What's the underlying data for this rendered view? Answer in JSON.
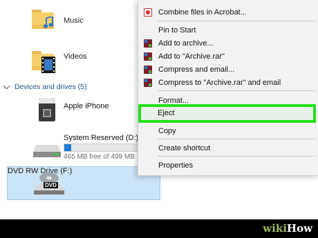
{
  "folders": [
    {
      "label": "Music"
    },
    {
      "label": "Videos"
    }
  ],
  "section": {
    "label": "Devices and drives (5)"
  },
  "devices": {
    "iphone": {
      "label": "Apple iPhone"
    },
    "system_reserved": {
      "label": "System Reserved (D:)",
      "free_text": "465 MB free of 499 MB",
      "used_fraction": 0.07
    },
    "dvd": {
      "label": "DVD RW Drive (F:)",
      "badge": "DVD"
    }
  },
  "context_menu": {
    "combine": "Combine files in Acrobat...",
    "pin": "Pin to Start",
    "add_archive": "Add to archive...",
    "add_rar": "Add to \"Archive.rar\"",
    "compress_email": "Compress and email...",
    "compress_rar_email": "Compress to \"Archive.rar\" and email",
    "format": "Format...",
    "eject": "Eject",
    "copy": "Copy",
    "shortcut": "Create shortcut",
    "properties": "Properties"
  },
  "colors": {
    "highlight": "#22e11a",
    "selection": "#cce4f7",
    "drive_bar": "#1f7cd1"
  },
  "watermark": {
    "part1": "wiki",
    "part2": "How"
  }
}
